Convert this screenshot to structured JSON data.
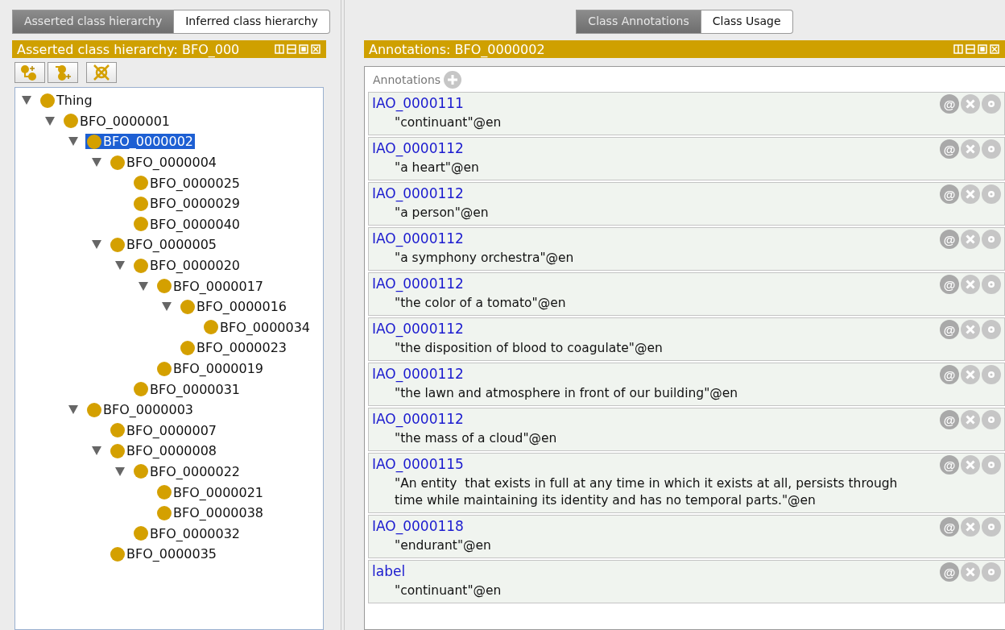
{
  "left_tabs": [
    {
      "label": "Asserted class hierarchy",
      "selected": true
    },
    {
      "label": "Inferred class hierarchy",
      "selected": false
    }
  ],
  "hierarchy_view": {
    "title": "Asserted class hierarchy: BFO_000",
    "tree": [
      {
        "label": "Thing",
        "expanded": true,
        "selected": false,
        "children": [
          {
            "label": "BFO_0000001",
            "expanded": true,
            "selected": false,
            "children": [
              {
                "label": "BFO_0000002",
                "expanded": true,
                "selected": true,
                "children": [
                  {
                    "label": "BFO_0000004",
                    "expanded": true,
                    "selected": false,
                    "children": [
                      {
                        "label": "BFO_0000025",
                        "selected": false
                      },
                      {
                        "label": "BFO_0000029",
                        "selected": false
                      },
                      {
                        "label": "BFO_0000040",
                        "selected": false
                      }
                    ]
                  },
                  {
                    "label": "BFO_0000005",
                    "expanded": true,
                    "selected": false,
                    "children": [
                      {
                        "label": "BFO_0000020",
                        "expanded": true,
                        "selected": false,
                        "children": [
                          {
                            "label": "BFO_0000017",
                            "expanded": true,
                            "selected": false,
                            "children": [
                              {
                                "label": "BFO_0000016",
                                "expanded": true,
                                "selected": false,
                                "children": [
                                  {
                                    "label": "BFO_0000034",
                                    "selected": false
                                  }
                                ]
                              },
                              {
                                "label": "BFO_0000023",
                                "selected": false
                              }
                            ]
                          },
                          {
                            "label": "BFO_0000019",
                            "selected": false
                          }
                        ]
                      },
                      {
                        "label": "BFO_0000031",
                        "selected": false
                      }
                    ]
                  }
                ]
              },
              {
                "label": "BFO_0000003",
                "expanded": true,
                "selected": false,
                "children": [
                  {
                    "label": "BFO_0000007",
                    "selected": false
                  },
                  {
                    "label": "BFO_0000008",
                    "expanded": true,
                    "selected": false,
                    "children": [
                      {
                        "label": "BFO_0000022",
                        "expanded": true,
                        "selected": false,
                        "children": [
                          {
                            "label": "BFO_0000021",
                            "selected": false
                          },
                          {
                            "label": "BFO_0000038",
                            "selected": false
                          }
                        ]
                      },
                      {
                        "label": "BFO_0000032",
                        "selected": false
                      }
                    ]
                  },
                  {
                    "label": "BFO_0000035",
                    "selected": false
                  }
                ]
              }
            ]
          }
        ]
      }
    ]
  },
  "right_tabs": [
    {
      "label": "Class Annotations",
      "selected": true
    },
    {
      "label": "Class Usage",
      "selected": false
    }
  ],
  "annotations_view": {
    "title": "Annotations: BFO_0000002",
    "section_label": "Annotations",
    "annotations": [
      {
        "property": "IAO_0000111",
        "value": "\"continuant\"@en",
        "at_label": "@"
      },
      {
        "property": "IAO_0000112",
        "value": "\"a heart\"@en",
        "at_label": "@"
      },
      {
        "property": "IAO_0000112",
        "value": "\"a person\"@en",
        "at_label": "@"
      },
      {
        "property": "IAO_0000112",
        "value": "\"a symphony orchestra\"@en",
        "at_label": "@"
      },
      {
        "property": "IAO_0000112",
        "value": "\"the color of a tomato\"@en",
        "at_label": "@"
      },
      {
        "property": "IAO_0000112",
        "value": "\"the disposition of blood to coagulate\"@en",
        "at_label": "@"
      },
      {
        "property": "IAO_0000112",
        "value": "\"the lawn and atmosphere in front of our building\"@en",
        "at_label": "@"
      },
      {
        "property": "IAO_0000112",
        "value": "\"the mass of a cloud\"@en",
        "at_label": "@"
      },
      {
        "property": "IAO_0000115",
        "value": "\"An entity  that exists in full at any time in which it exists at all, persists through time while maintaining its identity and has no temporal parts.\"@en",
        "at_label": "@"
      },
      {
        "property": "IAO_0000118",
        "value": "\"endurant\"@en",
        "at_label": "@"
      },
      {
        "property": "label",
        "value": "\"continuant\"@en",
        "at_label": "@"
      }
    ]
  }
}
